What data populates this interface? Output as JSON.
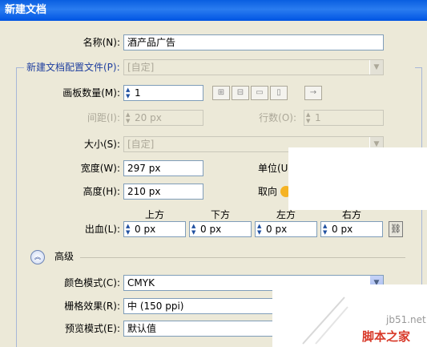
{
  "window": {
    "title": "新建文档"
  },
  "form": {
    "name_label": "名称(N):",
    "name_value": "酒产品广告",
    "profile_label": "新建文档配置文件(P):",
    "profile_value": "[自定]",
    "artboards_label": "画板数量(M):",
    "artboards_value": "1",
    "spacing_label": "间距(I):",
    "spacing_value": "20 px",
    "rows_label": "行数(O):",
    "rows_value": "1",
    "size_label": "大小(S):",
    "size_value": "[自定]",
    "width_label": "宽度(W):",
    "width_value": "297 px",
    "units_label": "单位(U",
    "height_label": "高度(H):",
    "height_value": "210 px",
    "orientation_label": "取向",
    "bleed_label": "出血(L):",
    "bleed": [
      {
        "label": "上方",
        "value": "0 px"
      },
      {
        "label": "下方",
        "value": "0 px"
      },
      {
        "label": "左方",
        "value": "0 px"
      },
      {
        "label": "右方",
        "value": "0 px"
      }
    ],
    "advanced_label": "高级",
    "color_mode_label": "颜色模式(C):",
    "color_mode_value": "CMYK",
    "raster_label": "栅格效果(R):",
    "raster_value": "中 (150 ppi)",
    "preview_label": "预览模式(E):",
    "preview_value": "默认值"
  },
  "icons": {
    "grid_by_row": "grid-by-row-icon",
    "grid_by_col": "grid-by-column-icon",
    "arrange_by_row": "arrange-by-row-icon",
    "arrange_by_col": "arrange-by-column-icon",
    "layout_direction": "arrow-right-icon",
    "link_bleed": "link-icon",
    "advanced_toggle": "double-chevron-up-icon"
  },
  "watermark": {
    "site": "jb51.net",
    "brand": "脚本之家"
  },
  "colors": {
    "title_bar": "#0a5fe0",
    "dialog_bg": "#ece9d8",
    "field_border": "#7f9db9",
    "watermark_red": "#d83a2a"
  }
}
